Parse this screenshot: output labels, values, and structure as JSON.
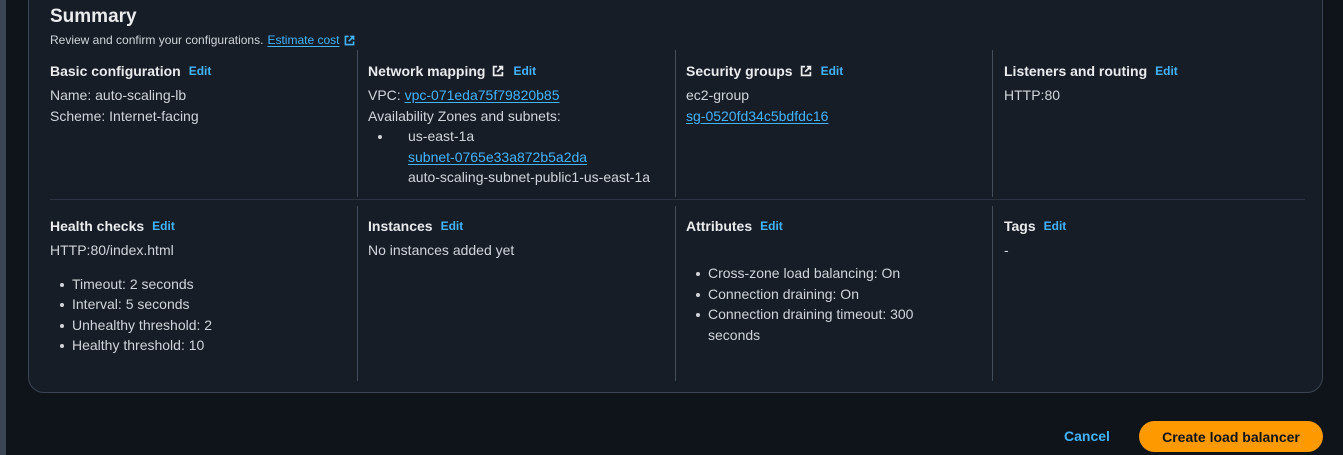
{
  "summary": {
    "title": "Summary",
    "subtitle": "Review and confirm your configurations.",
    "estimate_cost_link": "Estimate cost"
  },
  "edit_label": "Edit",
  "basic": {
    "title": "Basic configuration",
    "name": "Name: auto-scaling-lb",
    "scheme": "Scheme: Internet-facing"
  },
  "network": {
    "title": "Network mapping",
    "vpc_label": "VPC: ",
    "vpc_id": "vpc-071eda75f79820b85",
    "az_label": "Availability Zones and subnets:",
    "az": "us-east-1a",
    "subnet_id": "subnet-0765e33a872b5a2da",
    "subnet_name": "auto-scaling-subnet-public1-us-east-1a"
  },
  "security": {
    "title": "Security groups",
    "group_name": "ec2-group",
    "group_id": "sg-0520fd34c5bdfdc16"
  },
  "listeners": {
    "title": "Listeners and routing",
    "value": "HTTP:80"
  },
  "health": {
    "title": "Health checks",
    "path": "HTTP:80/index.html",
    "items": [
      "Timeout: 2 seconds",
      "Interval: 5 seconds",
      "Unhealthy threshold: 2",
      "Healthy threshold: 10"
    ]
  },
  "instances": {
    "title": "Instances",
    "value": "No instances added yet"
  },
  "attributes": {
    "title": "Attributes",
    "items": [
      "Cross-zone load balancing: On",
      "Connection draining: On",
      "Connection draining timeout: 300 seconds"
    ]
  },
  "tags": {
    "title": "Tags",
    "value": "-"
  },
  "footer": {
    "cancel": "Cancel",
    "create": "Create load balancer"
  }
}
